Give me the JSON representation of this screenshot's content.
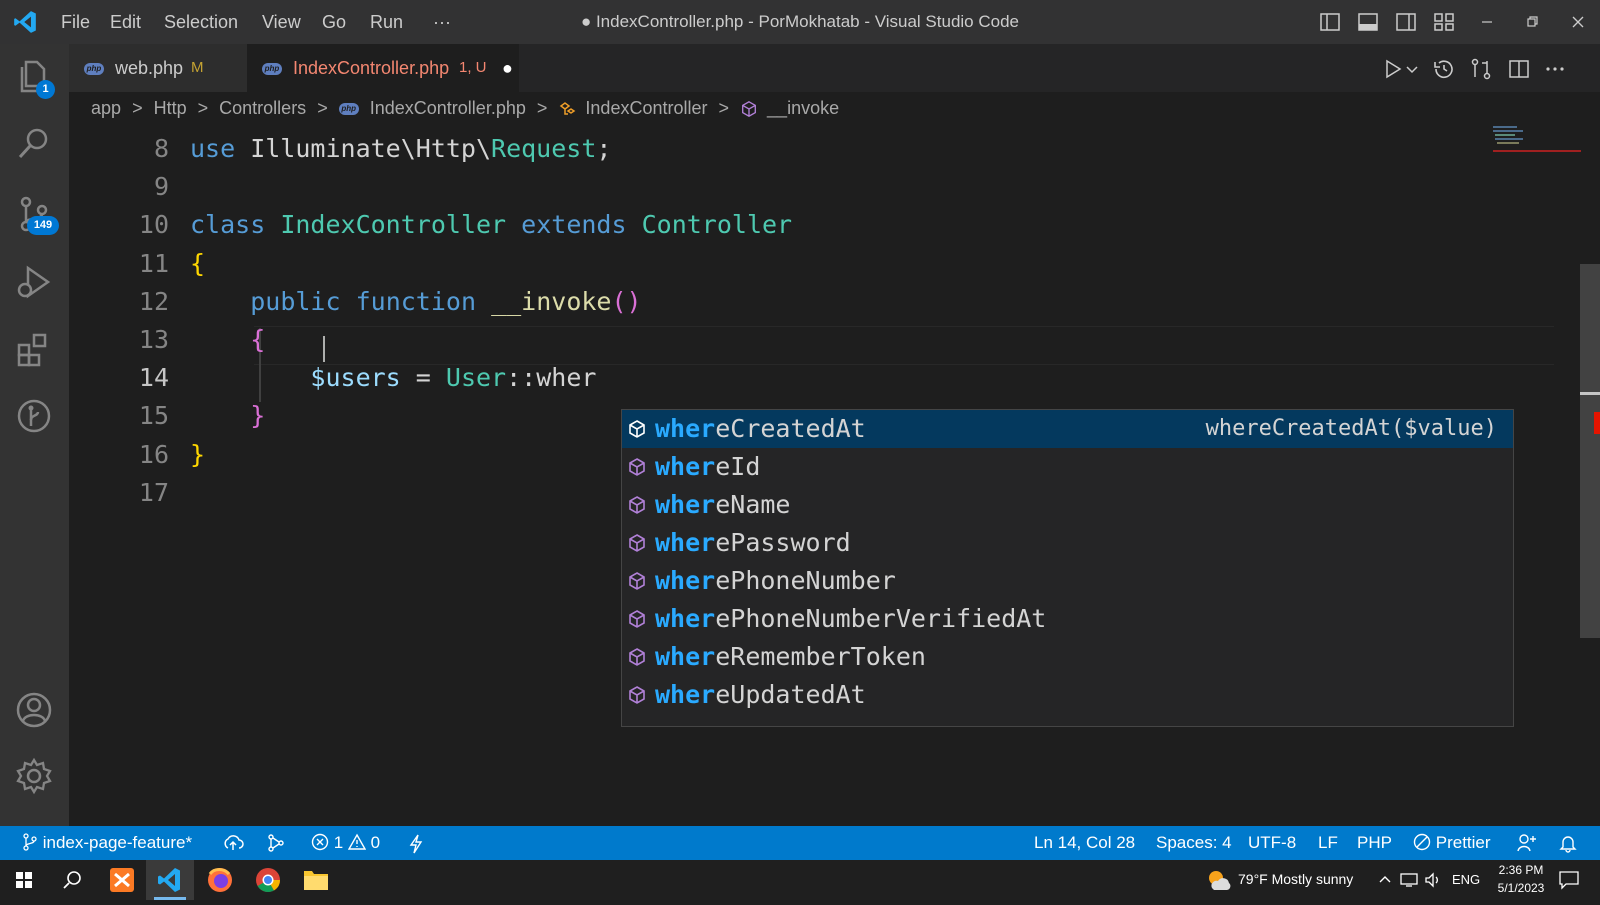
{
  "titlebar": {
    "menu": [
      "File",
      "Edit",
      "Selection",
      "View",
      "Go",
      "Run",
      "···"
    ],
    "window_title": "● IndexController.php - PorMokhatab - Visual Studio Code"
  },
  "activity": {
    "explorer_badge": "1",
    "scm_badge": "149"
  },
  "tabs": [
    {
      "label": "web.php",
      "status": "M"
    },
    {
      "label": "IndexController.php",
      "status": "1, U",
      "dirty": "●"
    }
  ],
  "breadcrumb": [
    "app",
    ">",
    "Http",
    ">",
    "Controllers",
    ">",
    "IndexController.php",
    ">",
    "IndexController",
    ">",
    "__invoke"
  ],
  "editor": {
    "lines": [
      {
        "n": "8",
        "tokens": [
          [
            "k",
            "use"
          ],
          [
            "o",
            " Illuminate\\Http\\"
          ],
          [
            "t",
            "Request"
          ],
          [
            "o",
            ";"
          ]
        ]
      },
      {
        "n": "9",
        "tokens": []
      },
      {
        "n": "10",
        "tokens": [
          [
            "k",
            "class"
          ],
          [
            "o",
            " "
          ],
          [
            "t",
            "IndexController"
          ],
          [
            "o",
            " "
          ],
          [
            "k",
            "extends"
          ],
          [
            "o",
            " "
          ],
          [
            "t",
            "Controller"
          ]
        ]
      },
      {
        "n": "11",
        "tokens": [
          [
            "b1",
            "{"
          ]
        ]
      },
      {
        "n": "12",
        "tokens": [
          [
            "o",
            "    "
          ],
          [
            "k",
            "public"
          ],
          [
            "o",
            " "
          ],
          [
            "k",
            "function"
          ],
          [
            "o",
            " "
          ],
          [
            "f",
            "__invoke"
          ],
          [
            "b2",
            "()"
          ]
        ]
      },
      {
        "n": "13",
        "tokens": [
          [
            "o",
            "    "
          ],
          [
            "b2",
            "{"
          ]
        ]
      },
      {
        "n": "14",
        "tokens": [
          [
            "o",
            "        "
          ],
          [
            "v",
            "$users"
          ],
          [
            "o",
            " = "
          ],
          [
            "t",
            "User"
          ],
          [
            "o",
            "::wher"
          ]
        ]
      },
      {
        "n": "15",
        "tokens": [
          [
            "o",
            "    "
          ],
          [
            "b2",
            "}"
          ]
        ]
      },
      {
        "n": "16",
        "tokens": [
          [
            "b1",
            "}"
          ]
        ]
      },
      {
        "n": "17",
        "tokens": []
      }
    ]
  },
  "suggest": {
    "match": "wher",
    "items": [
      {
        "rest": "eCreatedAt",
        "detail": "whereCreatedAt($value)"
      },
      {
        "rest": "eId"
      },
      {
        "rest": "eName"
      },
      {
        "rest": "ePassword"
      },
      {
        "rest": "ePhoneNumber"
      },
      {
        "rest": "ePhoneNumberVerifiedAt"
      },
      {
        "rest": "eRememberToken"
      },
      {
        "rest": "eUpdatedAt"
      }
    ]
  },
  "statusbar": {
    "branch": "index-page-feature*",
    "errors": "1",
    "warnings": "0",
    "position": "Ln 14, Col 28",
    "spaces": "Spaces: 4",
    "encoding": "UTF-8",
    "eol": "LF",
    "language": "PHP",
    "formatter": "Prettier"
  },
  "taskbar": {
    "weather": "79°F  Mostly sunny",
    "lang": "ENG",
    "time": "2:36 PM",
    "date": "5/1/2023"
  },
  "colors": {
    "accent": "#007acc",
    "tab_modified": "#f48771",
    "match_highlight": "#2aaaff"
  }
}
